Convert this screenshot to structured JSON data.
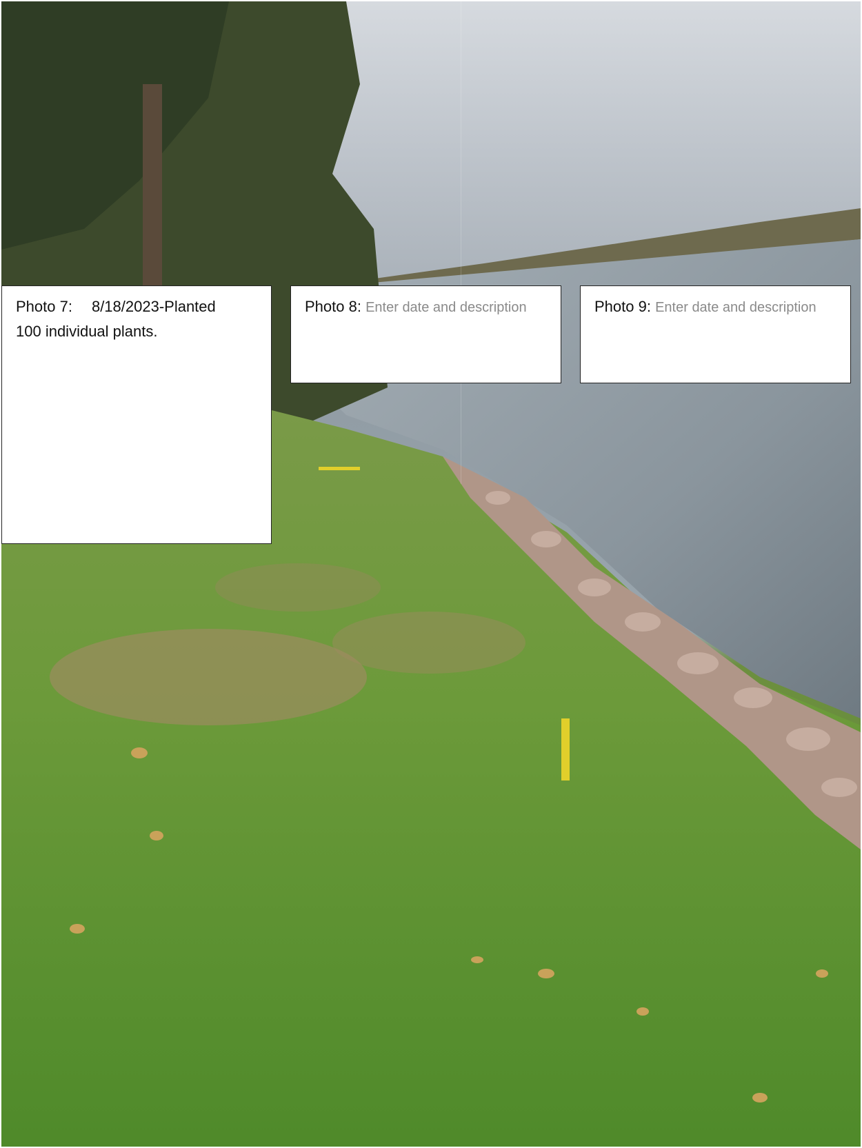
{
  "captions": [
    {
      "label": "Photo 7:",
      "date": "8/18/2023-Planted",
      "text": "100 individual plants."
    },
    {
      "label": "Photo 8:",
      "placeholder": "Enter date and description"
    },
    {
      "label": "Photo 9:",
      "placeholder": "Enter date and description"
    }
  ],
  "colors": {
    "sky": "#c5cad0",
    "water": "#8e9aa3",
    "grass": "#5e8a32",
    "rocks": "#b3998a",
    "box_border": "#222222",
    "placeholder_text": "#8a8a8a"
  }
}
